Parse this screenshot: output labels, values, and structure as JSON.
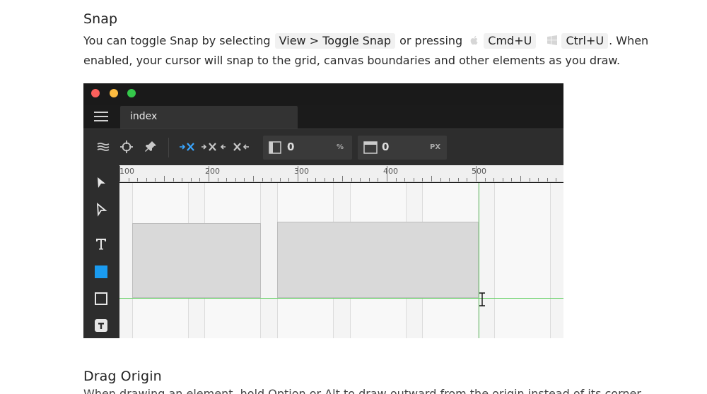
{
  "snap": {
    "heading": "Snap",
    "text_1": "You can toggle Snap by selecting ",
    "menu_path": "View > Toggle Snap",
    "text_2": " or pressing ",
    "mac_shortcut": "Cmd+U",
    "win_shortcut": "Ctrl+U",
    "text_3": ". When enabled, your cursor will snap to the grid, canvas boundaries and other elements as you draw."
  },
  "app": {
    "tab_label": "index",
    "field_1_value": "0",
    "field_1_unit": "%",
    "field_2_value": "0",
    "field_2_unit": "PX",
    "ruler_labels": [
      "100",
      "200",
      "300",
      "400",
      "500"
    ],
    "traffic_colors": {
      "close": "#fc605c",
      "minimize": "#fdbc40",
      "maximize": "#34c84a"
    },
    "accent": "#1a9bf0"
  },
  "drag_origin": {
    "heading": "Drag Origin",
    "partial_text": "When drawing an element, hold  Option  or  Alt  to draw outward from the origin instead of its corner."
  }
}
